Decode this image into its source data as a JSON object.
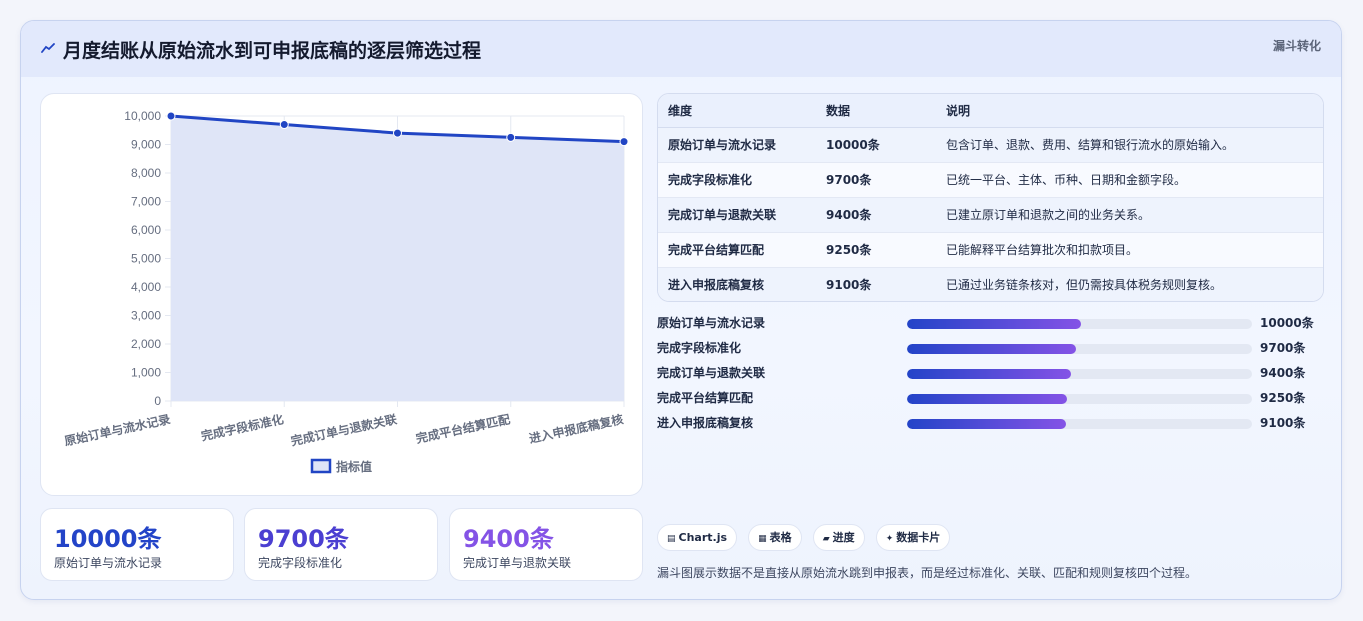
{
  "header": {
    "title": "月度结账从原始流水到可申报底稿的逐层筛选过程",
    "tag": "漏斗转化"
  },
  "chart_data": {
    "type": "line",
    "categories": [
      "原始订单与流水记录",
      "完成字段标准化",
      "完成订单与退款关联",
      "完成平台结算匹配",
      "进入申报底稿复核"
    ],
    "series": [
      {
        "name": "指标值",
        "values": [
          10000,
          9700,
          9400,
          9250,
          9100
        ]
      }
    ],
    "ylim": [
      0,
      10000
    ],
    "yticks": [
      "10,000",
      "9,000",
      "8,000",
      "7,000",
      "6,000",
      "5,000",
      "4,000",
      "3,000",
      "2,000",
      "1,000",
      "0"
    ],
    "ytick_values": [
      10000,
      9000,
      8000,
      7000,
      6000,
      5000,
      4000,
      3000,
      2000,
      1000,
      0
    ],
    "legend": {
      "label": "指标值",
      "position": "bottom"
    },
    "fill": true,
    "grid": true,
    "line_color": "#2145c4",
    "fill_color": "#dfe5f7"
  },
  "table": {
    "headers": [
      "维度",
      "数据",
      "说明"
    ],
    "rows": [
      [
        "原始订单与流水记录",
        "10000条",
        "包含订单、退款、费用、结算和银行流水的原始输入。"
      ],
      [
        "完成字段标准化",
        "9700条",
        "已统一平台、主体、币种、日期和金额字段。"
      ],
      [
        "完成订单与退款关联",
        "9400条",
        "已建立原订单和退款之间的业务关系。"
      ],
      [
        "完成平台结算匹配",
        "9250条",
        "已能解释平台结算批次和扣款项目。"
      ],
      [
        "进入申报底稿复核",
        "9100条",
        "已通过业务链条核对，但仍需按具体税务规则复核。"
      ]
    ]
  },
  "progress": [
    {
      "label": "原始订单与流水记录",
      "value": "10000条",
      "fraction": 0.505
    },
    {
      "label": "完成字段标准化",
      "value": "9700条",
      "fraction": 0.49
    },
    {
      "label": "完成订单与退款关联",
      "value": "9400条",
      "fraction": 0.475
    },
    {
      "label": "完成平台结算匹配",
      "value": "9250条",
      "fraction": 0.465
    },
    {
      "label": "进入申报底稿复核",
      "value": "9100条",
      "fraction": 0.46
    }
  ],
  "stats": [
    {
      "value": "10000条",
      "label": "原始订单与流水记录",
      "color": "#2344c8"
    },
    {
      "value": "9700条",
      "label": "完成字段标准化",
      "color": "#4b3fd1"
    },
    {
      "value": "9400条",
      "label": "完成订单与退款关联",
      "color": "#8453e6"
    }
  ],
  "chips": [
    {
      "icon": "▤",
      "label": "Chart.js"
    },
    {
      "icon": "▦",
      "label": "表格"
    },
    {
      "icon": "▰",
      "label": "进度"
    },
    {
      "icon": "✦",
      "label": "数据卡片"
    }
  ],
  "footnote": "漏斗图展示数据不是直接从原始流水跳到申报表，而是经过标准化、关联、匹配和规则复核四个过程。"
}
